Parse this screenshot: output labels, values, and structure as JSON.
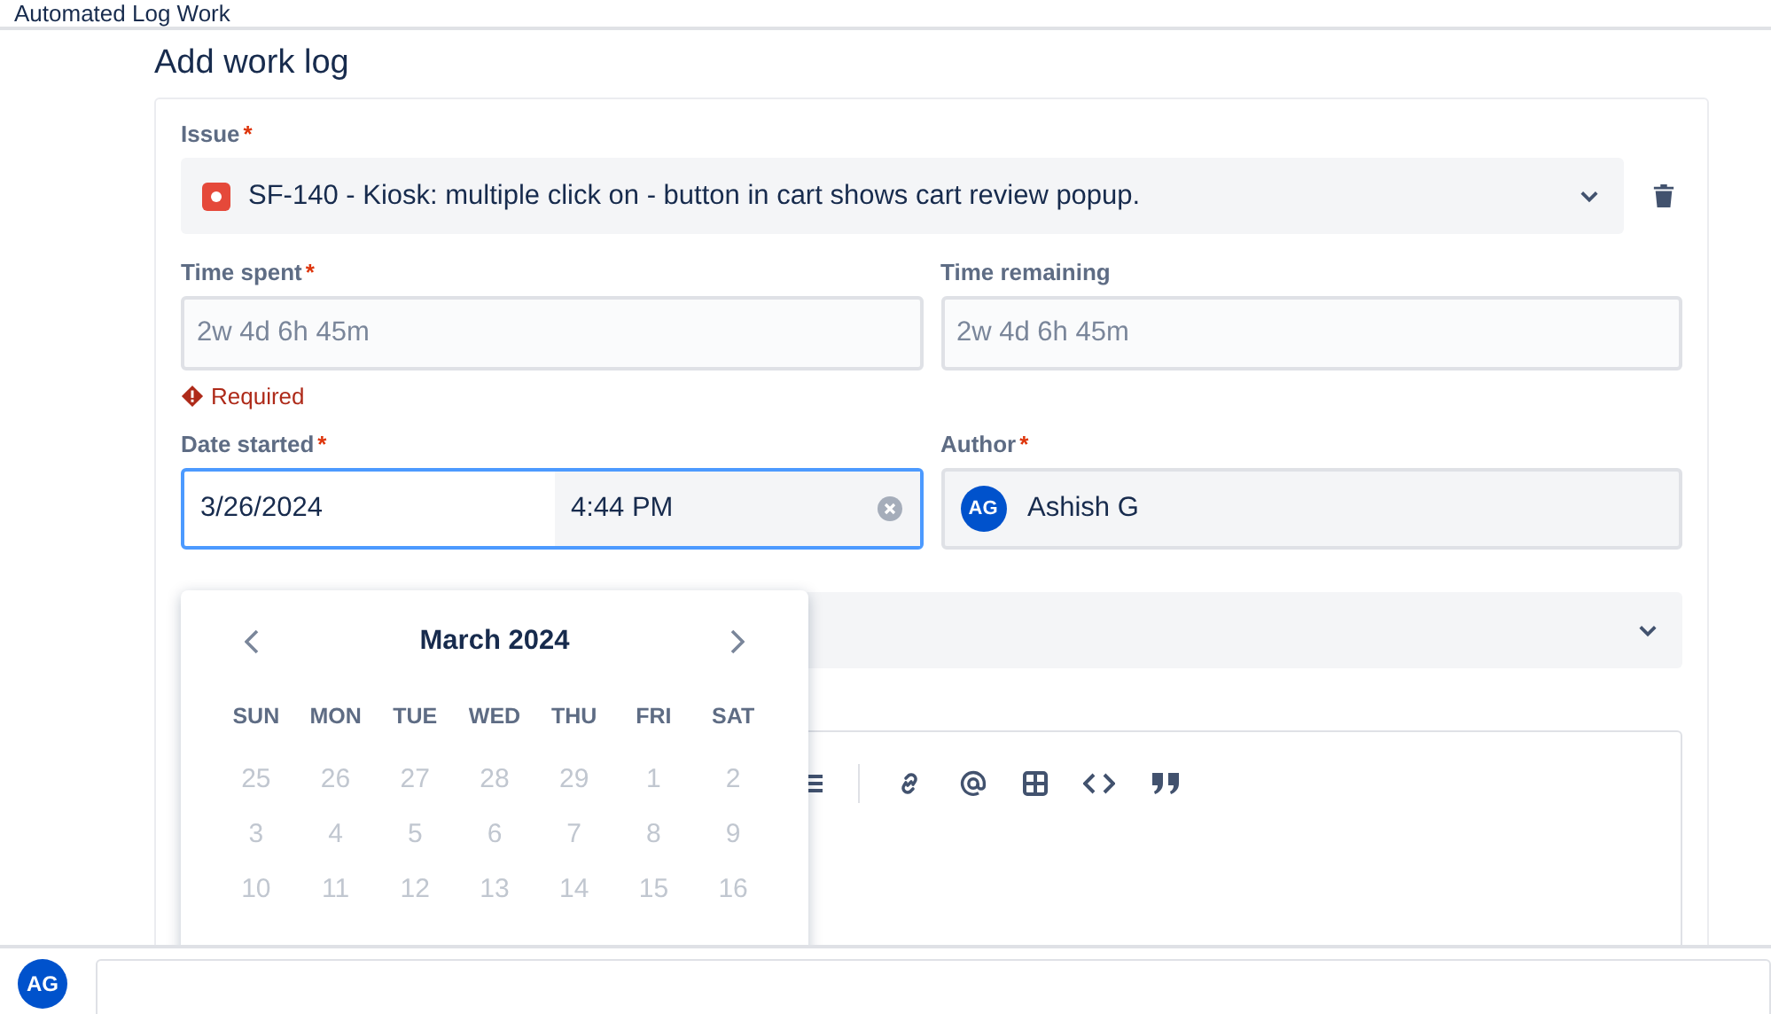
{
  "page_title": "Automated Log Work",
  "heading": "Add work log",
  "issue": {
    "label": "Issue",
    "required_mark": "*",
    "value": "SF-140 - Kiosk: multiple click on - button in cart shows cart review popup."
  },
  "time_spent": {
    "label": "Time spent",
    "required_mark": "*",
    "placeholder": "2w 4d 6h 45m",
    "error": "Required"
  },
  "time_remaining": {
    "label": "Time remaining",
    "placeholder": "2w 4d 6h 45m"
  },
  "date_started": {
    "label": "Date started",
    "required_mark": "*",
    "date": "3/26/2024",
    "time": "4:44 PM"
  },
  "author": {
    "label": "Author",
    "required_mark": "*",
    "initials": "AG",
    "name": "Ashish G"
  },
  "calendar": {
    "month": "March 2024",
    "weekdays": [
      "SUN",
      "MON",
      "TUE",
      "WED",
      "THU",
      "FRI",
      "SAT"
    ],
    "weeks": [
      [
        {
          "label": "25",
          "disabled": true
        },
        {
          "label": "26",
          "disabled": true
        },
        {
          "label": "27",
          "disabled": true
        },
        {
          "label": "28",
          "disabled": true
        },
        {
          "label": "29",
          "disabled": true
        },
        {
          "label": "1",
          "disabled": true
        },
        {
          "label": "2",
          "disabled": true
        }
      ],
      [
        {
          "label": "3",
          "disabled": true
        },
        {
          "label": "4",
          "disabled": true
        },
        {
          "label": "5",
          "disabled": true
        },
        {
          "label": "6",
          "disabled": true
        },
        {
          "label": "7",
          "disabled": true
        },
        {
          "label": "8",
          "disabled": true
        },
        {
          "label": "9",
          "disabled": true
        }
      ],
      [
        {
          "label": "10",
          "disabled": true
        },
        {
          "label": "11",
          "disabled": true
        },
        {
          "label": "12",
          "disabled": true
        },
        {
          "label": "13",
          "disabled": true
        },
        {
          "label": "14",
          "disabled": true
        },
        {
          "label": "15",
          "disabled": true
        },
        {
          "label": "16",
          "disabled": true
        }
      ]
    ]
  },
  "comment": {
    "initials": "AG"
  }
}
